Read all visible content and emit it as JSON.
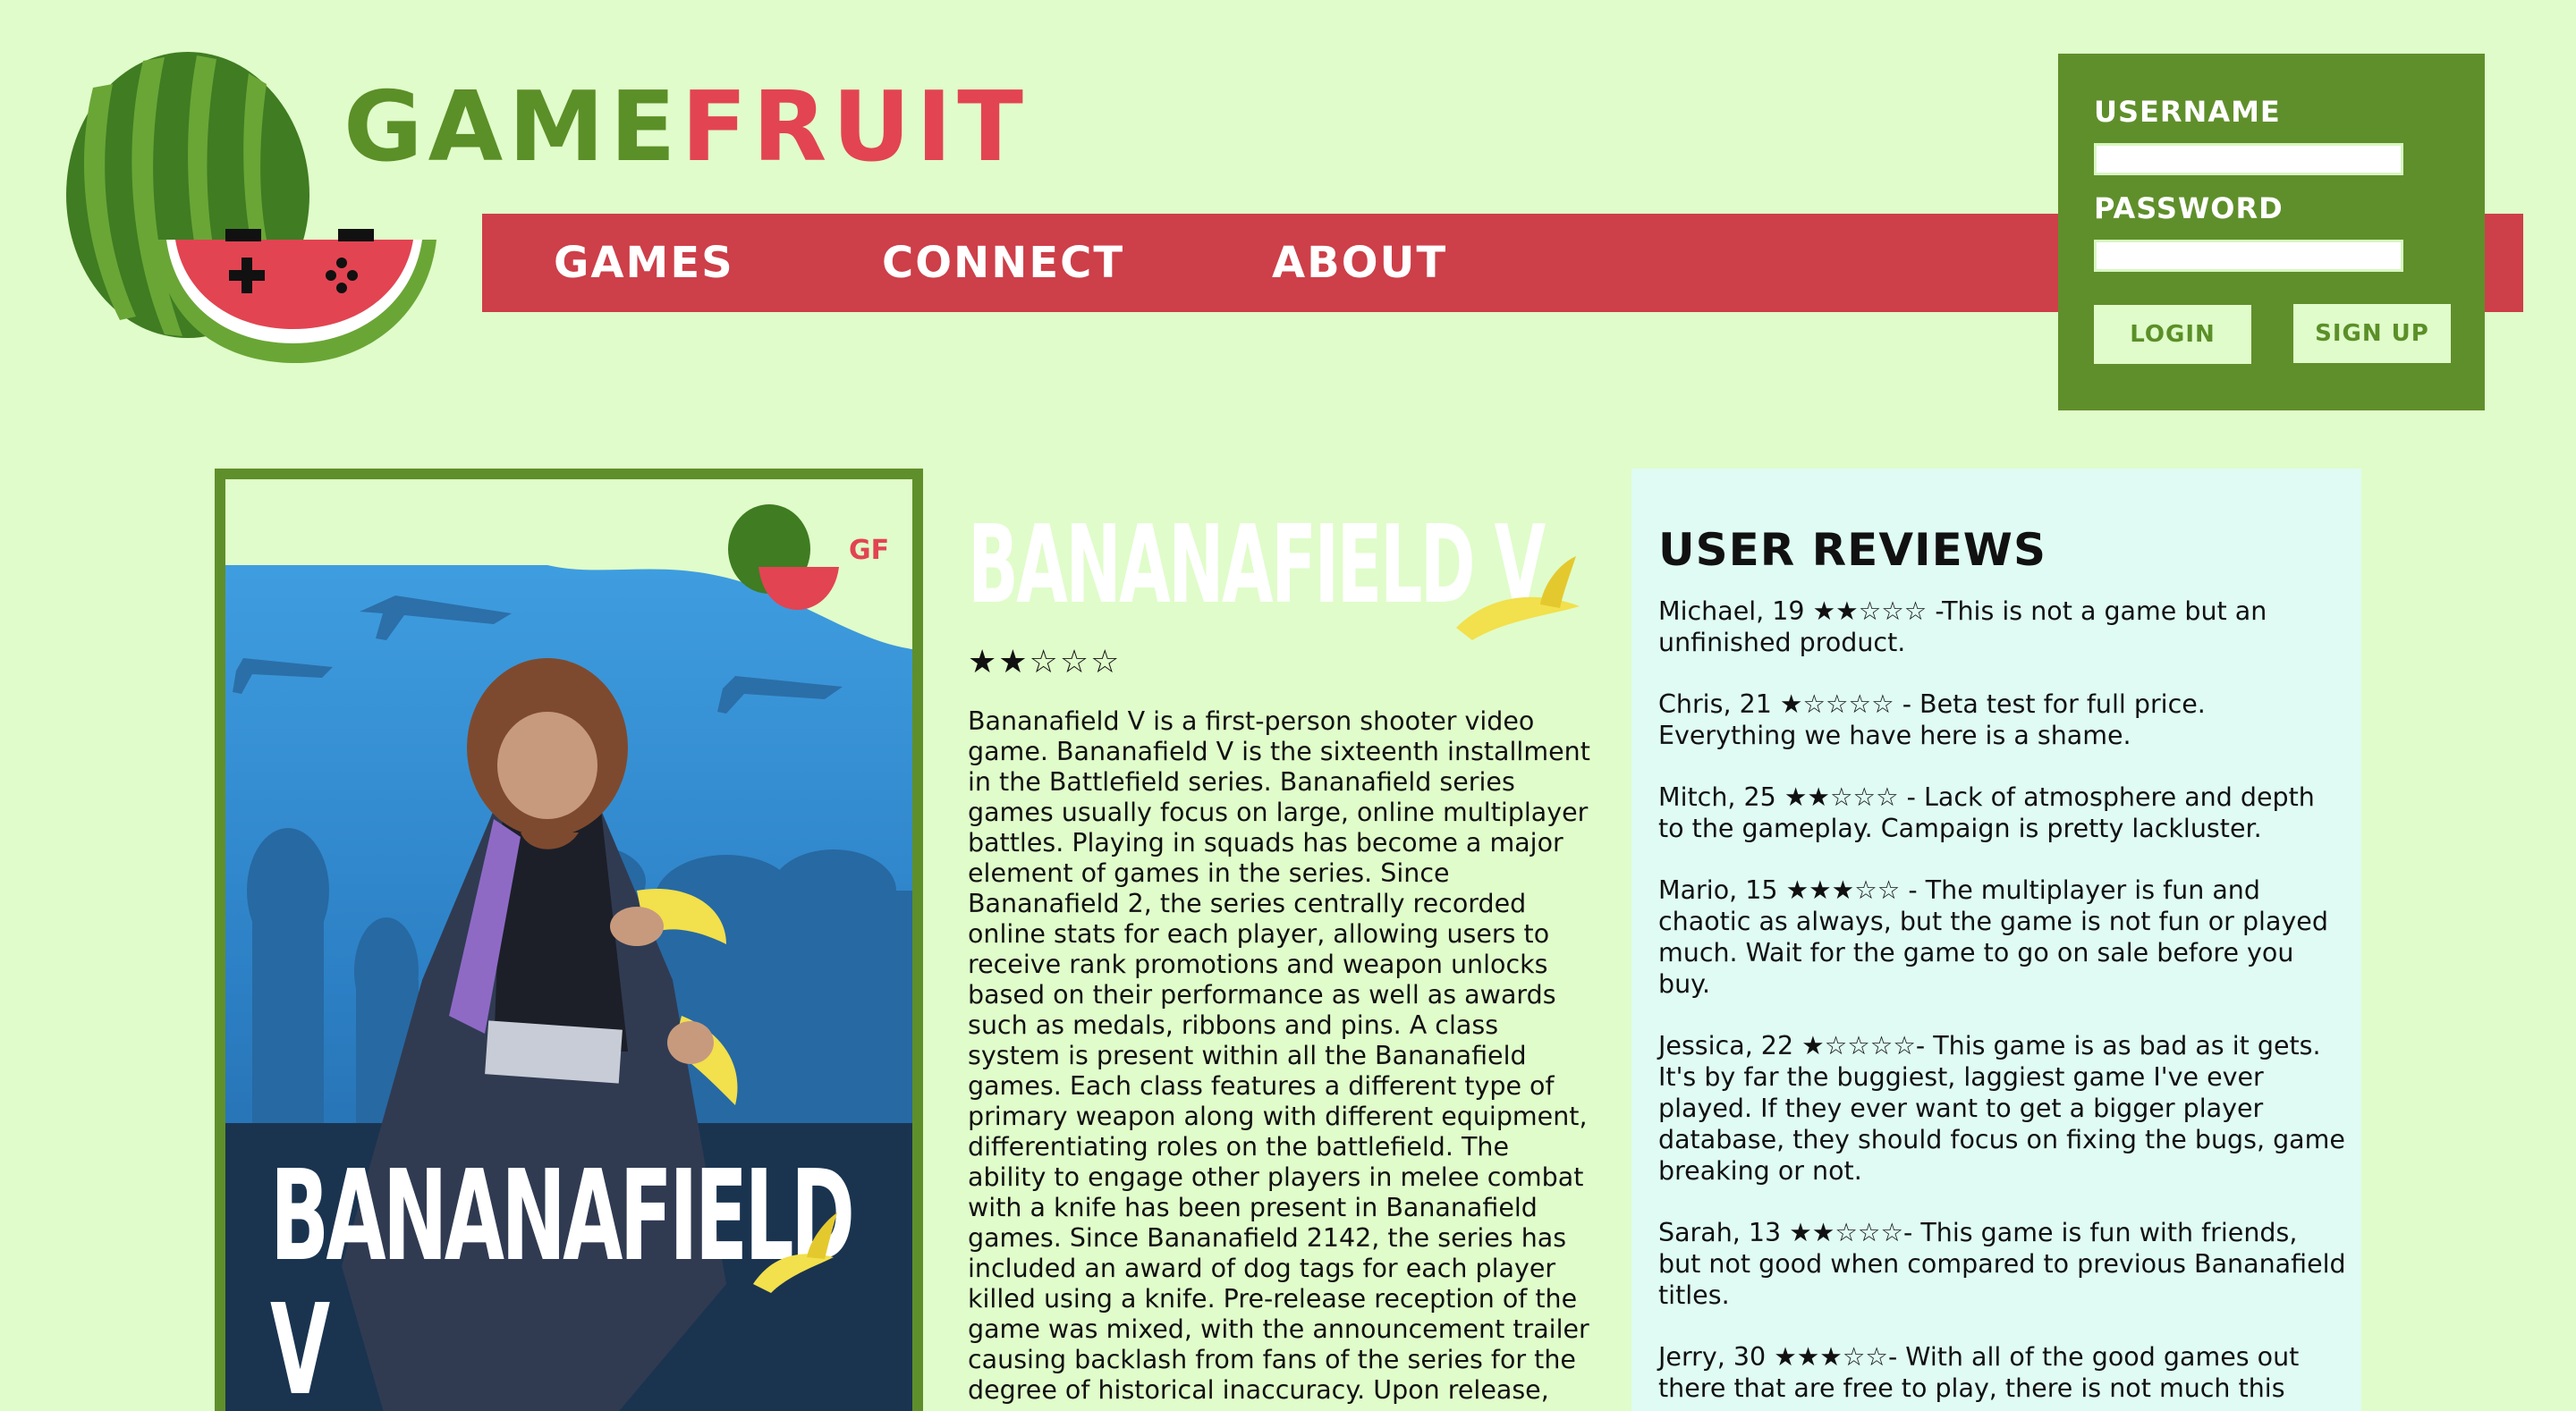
{
  "brand": {
    "part1": "GAME",
    "part2": "FRUIT",
    "colors": {
      "green": "#5b8f28",
      "red": "#e24452",
      "nav": "#cd3f49",
      "panel": "#5f8f2b",
      "background": "#e0fcca",
      "reviews_bg": "#dffbf3"
    }
  },
  "nav": {
    "items": [
      {
        "label": "GAMES"
      },
      {
        "label": "CONNECT"
      },
      {
        "label": "ABOUT"
      }
    ]
  },
  "login": {
    "username_label": "USERNAME",
    "password_label": "PASSWORD",
    "username_value": "",
    "password_value": "",
    "login_label": "LOGIN",
    "signup_label": "SIGN UP"
  },
  "poster": {
    "title": "BANANAFIELD V",
    "badge": "GF"
  },
  "game": {
    "title": "BANANAFIELD V",
    "rating": "★★☆☆☆",
    "description": "Bananafield V is a first-person shooter video game. Bananafield V is the sixteenth installment in the Battlefield series. Bananafield series games usually focus on large, online multiplayer battles. Playing in squads has become a major element of games in the series. Since Bananafield 2, the series centrally recorded online stats for each player, allowing users to receive rank promotions and weapon unlocks based on their performance as well as awards such as medals, ribbons and pins. A class system is present within all the Bananafield games. Each class features a different type of primary weapon along with different equipment, differentiating roles on the battlefield. The ability to engage other players in melee combat with a knife has been present in Bananafield games. Since Bananafield 2142, the series has included an award of dog tags for each player killed using a knife. Pre-release reception of the game was mixed, with the announcement trailer causing backlash from fans of the series for the degree of historical inaccuracy. Upon release,"
  },
  "reviews": {
    "title": "USER REVIEWS",
    "items": [
      {
        "author": "Michael, 19",
        "stars": "★★☆☆☆",
        "text": " -This is not a game but an unfinished product."
      },
      {
        "author": "Chris, 21",
        "stars": "★☆☆☆☆",
        "text": " - Beta test for full price. Everything we have here is a shame."
      },
      {
        "author": "Mitch, 25",
        "stars": "★★☆☆☆",
        "text": " - Lack of atmosphere and depth to the gameplay. Campaign is pretty lackluster."
      },
      {
        "author": "Mario, 15",
        "stars": "★★★☆☆",
        "text": " - The multiplayer is fun and chaotic as always, but the game is not fun or played much. Wait for the game to go on sale before you buy."
      },
      {
        "author": "Jessica, 22",
        "stars": "★☆☆☆☆",
        "text": "- This game is as bad as it gets. It's by far the buggiest, laggiest game I've ever played. If they ever want to get a bigger player database, they should focus on fixing the bugs, game breaking or not."
      },
      {
        "author": "Sarah, 13",
        "stars": "★★☆☆☆",
        "text": "- This game is fun with friends, but not good when compared to previous Bananafield titles."
      },
      {
        "author": "Jerry, 30",
        "stars": "★★★☆☆",
        "text": "- With all of the good games out there that are free to play, there is not much this"
      }
    ]
  }
}
